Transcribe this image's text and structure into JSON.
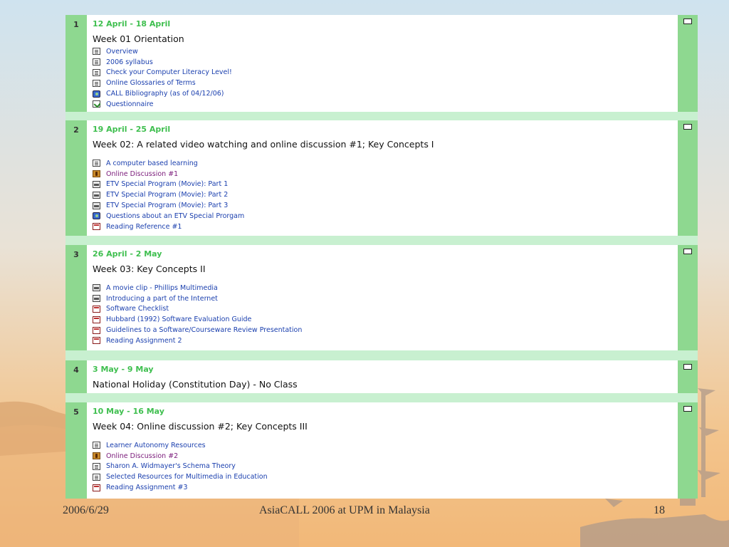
{
  "sections": [
    {
      "number": "1",
      "dates": "12 April - 18 April",
      "summary": "Week 01 Orientation",
      "items": [
        {
          "label": "Overview",
          "icon": "resource-icon"
        },
        {
          "label": "2006 syllabus",
          "icon": "resource-icon"
        },
        {
          "label": "Check your Computer Literacy Level!",
          "icon": "resource-icon"
        },
        {
          "label": "Online Glossaries of Terms",
          "icon": "resource-icon"
        },
        {
          "label": "CALL Bibliography (as of 04/12/06)",
          "icon": "globe-icon"
        },
        {
          "label": "Questionnaire",
          "icon": "quiz-icon"
        }
      ]
    },
    {
      "number": "2",
      "dates": "19 April - 25 April",
      "summary": "Week 02: A related video watching and online discussion #1; Key Concepts I",
      "items": [
        {
          "label": "A computer based learning",
          "icon": "resource-icon"
        },
        {
          "label": "Online Discussion #1",
          "icon": "forum-icon"
        },
        {
          "label": "ETV Special Program (Movie): Part 1",
          "icon": "video-icon"
        },
        {
          "label": "ETV Special Program (Movie): Part 2",
          "icon": "video-icon"
        },
        {
          "label": "ETV Special Program (Movie): Part 3",
          "icon": "video-icon"
        },
        {
          "label": "Questions about an ETV Special Prorgam",
          "icon": "globe-icon"
        },
        {
          "label": "Reading Reference #1",
          "icon": "pdf-icon"
        }
      ]
    },
    {
      "number": "3",
      "dates": "26 April - 2 May",
      "summary": "Week 03: Key Concepts II",
      "items": [
        {
          "label": "A movie clip - Phillips Multimedia",
          "icon": "video-icon"
        },
        {
          "label": "Introducing a part of the Internet",
          "icon": "video-icon"
        },
        {
          "label": "Software Checklist",
          "icon": "pdf-icon"
        },
        {
          "label": "Hubbard (1992) Software Evaluation Guide",
          "icon": "pdf-icon"
        },
        {
          "label": "Guidelines to a Software/Courseware Review Presentation",
          "icon": "pdf-icon"
        },
        {
          "label": "Reading Assignment 2",
          "icon": "pdf-icon"
        }
      ]
    },
    {
      "number": "4",
      "dates": "3 May - 9 May",
      "summary": "National Holiday (Constitution Day) - No Class",
      "items": []
    },
    {
      "number": "5",
      "dates": "10 May - 16 May",
      "summary": "Week 04: Online discussion #2; Key Concepts III",
      "items": [
        {
          "label": "Learner Autonomy Resources",
          "icon": "resource-icon"
        },
        {
          "label": "Online Discussion #2",
          "icon": "forum-icon"
        },
        {
          "label": "Sharon A. Widmayer's Schema Theory",
          "icon": "resource-icon"
        },
        {
          "label": "Selected Resources for Multimedia in Education",
          "icon": "resource-icon"
        },
        {
          "label": "Reading Assignment #3",
          "icon": "pdf-icon"
        }
      ]
    }
  ],
  "footer": {
    "date": "2006/6/29",
    "title": "AsiaCALL 2006 at UPM in Malaysia",
    "page": "18"
  }
}
